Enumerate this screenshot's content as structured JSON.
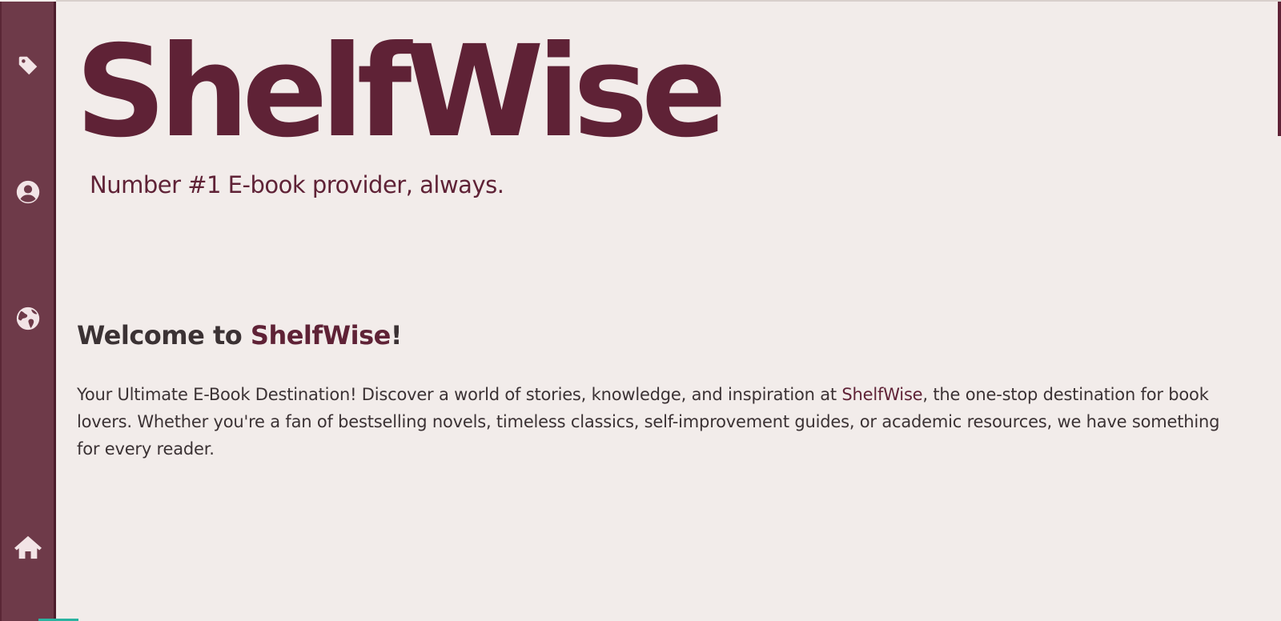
{
  "sidebar": {
    "items": [
      {
        "icon": "tag-icon",
        "name": "tag"
      },
      {
        "icon": "user-icon",
        "name": "user"
      },
      {
        "icon": "globe-icon",
        "name": "globe"
      },
      {
        "icon": "home-icon",
        "name": "home"
      }
    ]
  },
  "header": {
    "title": "ShelfWise",
    "tagline": "Number #1 E-book provider, always."
  },
  "welcome": {
    "prefix": "Welcome to ",
    "brand": "ShelfWise",
    "suffix": "!"
  },
  "intro": {
    "part1": "Your Ultimate E-Book Destination! Discover a world of stories, knowledge, and inspiration at ",
    "brand": "ShelfWise",
    "part2": ", the one-stop destination for book lovers. Whether you're a fan of bestselling novels, timeless classics, self-improvement guides, or academic resources, we have something for every reader."
  },
  "colors": {
    "brand": "#5f2236",
    "sidebar": "#6e3a49",
    "background": "#f2ecea",
    "text": "#3b3234",
    "icon": "#f2e4e6"
  }
}
